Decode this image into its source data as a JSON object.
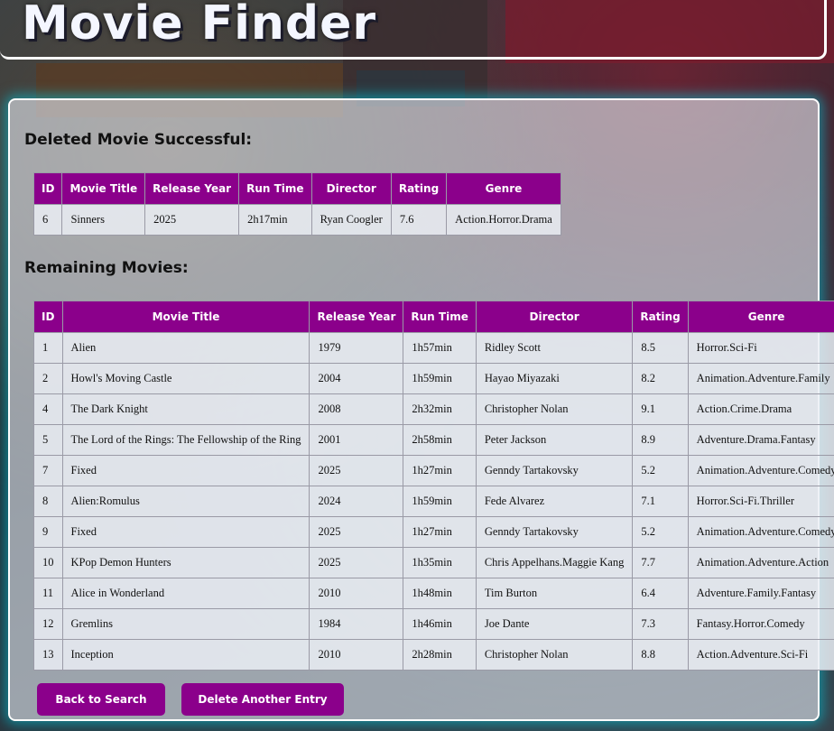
{
  "app": {
    "title": "Movie Finder"
  },
  "deleted_section": {
    "heading": "Deleted Movie Successful:",
    "columns": [
      "ID",
      "Movie Title",
      "Release Year",
      "Run Time",
      "Director",
      "Rating",
      "Genre"
    ],
    "rows": [
      [
        "6",
        "Sinners",
        "2025",
        "2h17min",
        "Ryan Coogler",
        "7.6",
        "Action.Horror.Drama"
      ]
    ]
  },
  "remaining_section": {
    "heading": "Remaining Movies:",
    "columns": [
      "ID",
      "Movie Title",
      "Release Year",
      "Run Time",
      "Director",
      "Rating",
      "Genre"
    ],
    "rows": [
      [
        "1",
        "Alien",
        "1979",
        "1h57min",
        "Ridley Scott",
        "8.5",
        "Horror.Sci-Fi"
      ],
      [
        "2",
        "Howl's Moving Castle",
        "2004",
        "1h59min",
        "Hayao Miyazaki",
        "8.2",
        "Animation.Adventure.Family"
      ],
      [
        "4",
        "The Dark Knight",
        "2008",
        "2h32min",
        "Christopher Nolan",
        "9.1",
        "Action.Crime.Drama"
      ],
      [
        "5",
        "The Lord of the Rings: The Fellowship of the Ring",
        "2001",
        "2h58min",
        "Peter Jackson",
        "8.9",
        "Adventure.Drama.Fantasy"
      ],
      [
        "7",
        "Fixed",
        "2025",
        "1h27min",
        "Genndy Tartakovsky",
        "5.2",
        "Animation.Adventure.Comedy"
      ],
      [
        "8",
        "Alien:Romulus",
        "2024",
        "1h59min",
        "Fede Alvarez",
        "7.1",
        "Horror.Sci-Fi.Thriller"
      ],
      [
        "9",
        "Fixed",
        "2025",
        "1h27min",
        "Genndy Tartakovsky",
        "5.2",
        "Animation.Adventure.Comedy"
      ],
      [
        "10",
        "KPop Demon Hunters",
        "2025",
        "1h35min",
        "Chris Appelhans.Maggie Kang",
        "7.7",
        "Animation.Adventure.Action"
      ],
      [
        "11",
        "Alice in Wonderland",
        "2010",
        "1h48min",
        "Tim Burton",
        "6.4",
        "Adventure.Family.Fantasy"
      ],
      [
        "12",
        "Gremlins",
        "1984",
        "1h46min",
        "Joe Dante",
        "7.3",
        "Fantasy.Horror.Comedy"
      ],
      [
        "13",
        "Inception",
        "2010",
        "2h28min",
        "Christopher Nolan",
        "8.8",
        "Action.Adventure.Sci-Fi"
      ]
    ]
  },
  "buttons": {
    "back": "Back to Search",
    "delete_another": "Delete Another Entry"
  },
  "colors": {
    "accent": "#8b008b",
    "panel_glow": "#00c8dc"
  }
}
